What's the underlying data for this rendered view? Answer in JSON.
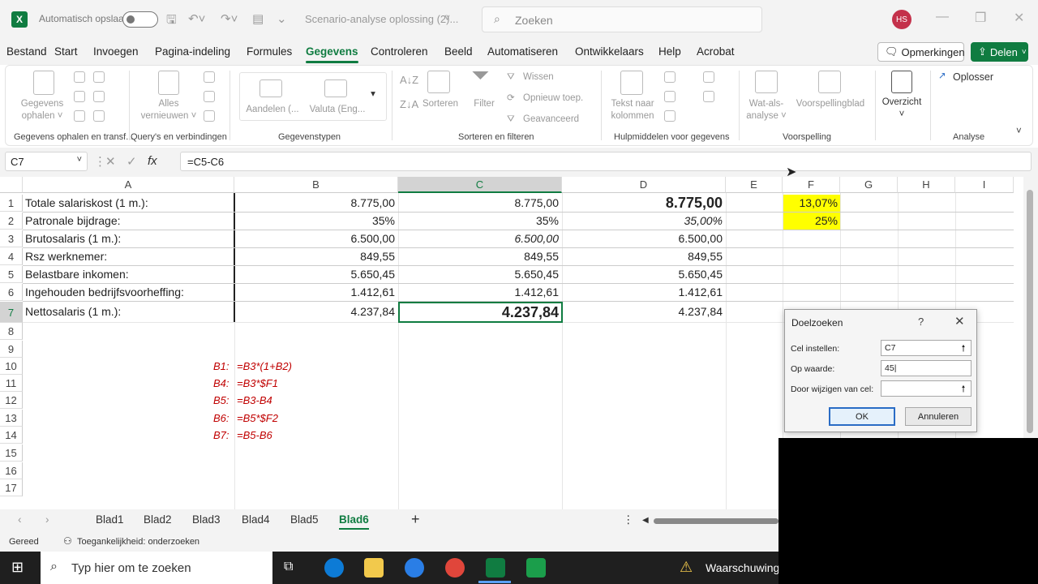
{
  "titlebar": {
    "autosave_label": "Automatisch opslaan",
    "doc_title": "Scenario-analyse oplossing (2)...",
    "search_placeholder": "Zoeken",
    "avatar_initials": "HS"
  },
  "menu": {
    "items": [
      "Bestand",
      "Start",
      "Invoegen",
      "Pagina-indeling",
      "Formules",
      "Gegevens",
      "Controleren",
      "Beeld",
      "Automatiseren",
      "Ontwikkelaars",
      "Help",
      "Acrobat"
    ],
    "active": "Gegevens",
    "comments_label": "Opmerkingen",
    "share_label": "Delen"
  },
  "ribbon": {
    "groups": {
      "get_data": "Gegevens ophalen en transf...",
      "queries": "Query's en verbindingen",
      "types": "Gegevenstypen",
      "sort_filter": "Sorteren en filteren",
      "tools": "Hulpmiddelen voor gegevens",
      "forecast": "Voorspelling",
      "analysis": "Analyse"
    },
    "labels": {
      "get_data_1": "Gegevens",
      "get_data_2": "ophalen ˅",
      "refresh_1": "Alles",
      "refresh_2": "vernieuwen ˅",
      "stocks": "Aandelen (...",
      "currency": "Valuta (Eng...",
      "sort": "Sorteren",
      "filter": "Filter",
      "clear": "Wissen",
      "reapply": "Opnieuw toep.",
      "advanced": "Geavanceerd",
      "text_to_cols_1": "Tekst naar",
      "text_to_cols_2": "kolommen",
      "whatif_1": "Wat-als-",
      "whatif_2": "analyse ˅",
      "forecast_sheet": "Voorspellingblad",
      "outline": "Overzicht",
      "solver": "Oplosser"
    }
  },
  "formula_bar": {
    "name_box": "C7",
    "formula": "=C5-C6"
  },
  "sheet": {
    "columns": [
      "A",
      "B",
      "C",
      "D",
      "E",
      "F",
      "G",
      "H",
      "I"
    ],
    "rows": [
      "1",
      "2",
      "3",
      "4",
      "5",
      "6",
      "7",
      "8",
      "9",
      "10",
      "11",
      "12",
      "13",
      "14",
      "15",
      "16",
      "17"
    ],
    "labels": [
      "Totale salariskost (1 m.):",
      "Patronale bijdrage:",
      "Brutosalaris (1 m.):",
      "Rsz werknemer:",
      "Belastbare inkomen:",
      "Ingehouden bedrijfsvoorheffing:",
      "Nettosalaris (1 m.):"
    ],
    "col_b": [
      "8.775,00",
      "35%",
      "6.500,00",
      "849,55",
      "5.650,45",
      "1.412,61",
      "4.237,84"
    ],
    "col_c": [
      "8.775,00",
      "35%",
      "6.500,00",
      "849,55",
      "5.650,45",
      "1.412,61",
      "4.237,84"
    ],
    "col_d": [
      "8.775,00",
      "35,00%",
      "6.500,00",
      "849,55",
      "5.650,45",
      "1.412,61",
      "4.237,84"
    ],
    "f1": "13,07%",
    "f2": "25%",
    "notes": [
      {
        "ref": "B1:",
        "formula": "=B3*(1+B2)"
      },
      {
        "ref": "B4:",
        "formula": "=B3*$F1"
      },
      {
        "ref": "B5:",
        "formula": "=B3-B4"
      },
      {
        "ref": "B6:",
        "formula": "=B5*$F2"
      },
      {
        "ref": "B7:",
        "formula": "=B5-B6"
      }
    ]
  },
  "tabs": {
    "items": [
      "Blad1",
      "Blad2",
      "Blad3",
      "Blad4",
      "Blad5",
      "Blad6"
    ],
    "active": "Blad6"
  },
  "status": {
    "ready": "Gereed",
    "accessibility": "Toegankelijkheid: onderzoeken"
  },
  "dialog": {
    "title": "Doelzoeken",
    "set_cell_label": "Cel instellen:",
    "set_cell_value": "C7",
    "to_value_label": "Op waarde:",
    "to_value_value": "45",
    "by_changing_label": "Door wijzigen van cel:",
    "by_changing_value": "",
    "ok_label": "OK",
    "cancel_label": "Annuleren"
  },
  "taskbar": {
    "search_placeholder": "Typ hier om te zoeken",
    "warning_label": "Waarschuwing"
  }
}
